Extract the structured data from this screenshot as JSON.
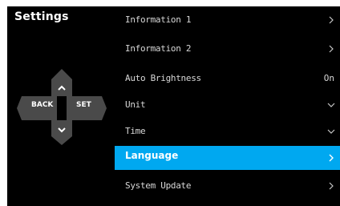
{
  "screen": {
    "title": "Settings"
  },
  "dpad": {
    "back_label": "BACK",
    "set_label": "SET",
    "up_icon": "chevron-up-icon",
    "down_icon": "chevron-down-icon"
  },
  "menu": {
    "items": [
      {
        "label": "Information 1",
        "value": "",
        "icon": "chevron-right-icon",
        "selected": false
      },
      {
        "label": "Information 2",
        "value": "",
        "icon": "chevron-right-icon",
        "selected": false
      },
      {
        "label": "Auto Brightness",
        "value": "On",
        "icon": "",
        "selected": false
      },
      {
        "label": "Unit",
        "value": "",
        "icon": "chevron-down-icon",
        "selected": false
      },
      {
        "label": "Time",
        "value": "",
        "icon": "chevron-down-icon",
        "selected": false
      },
      {
        "label": "Language",
        "value": "",
        "icon": "chevron-right-icon",
        "selected": true
      },
      {
        "label": "System Update",
        "value": "",
        "icon": "chevron-right-icon",
        "selected": false
      }
    ]
  },
  "colors": {
    "background": "#000000",
    "selected": "#00a8f0",
    "text": "#d8d8d8",
    "dpad": "#4a4a4a"
  }
}
